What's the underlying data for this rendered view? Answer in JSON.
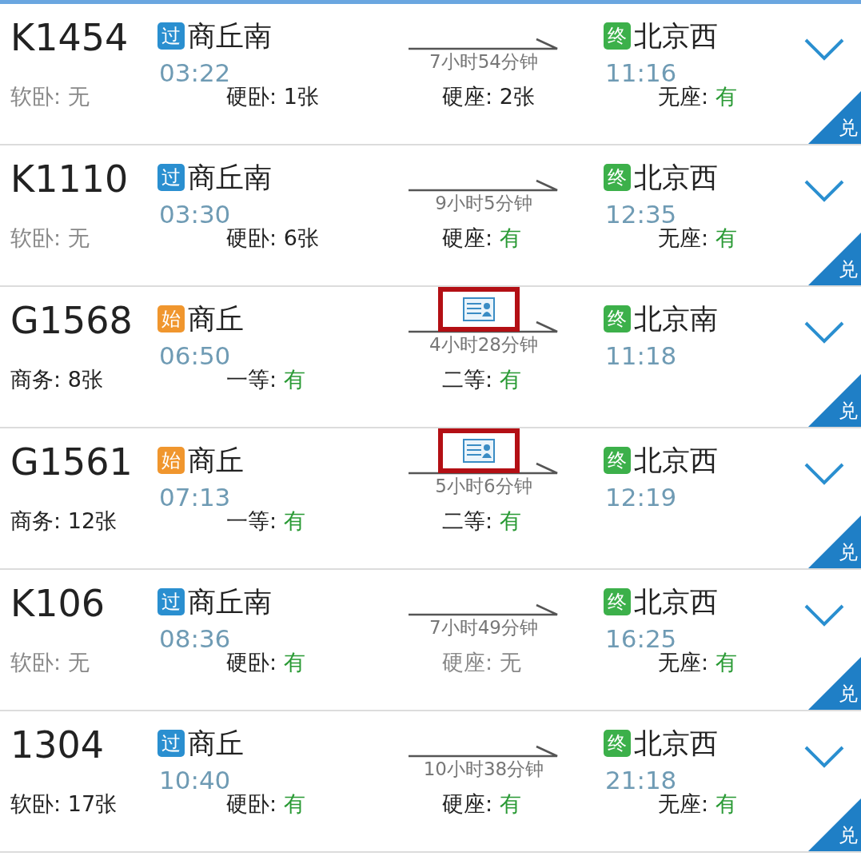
{
  "trains": [
    {
      "number": "K1454",
      "from": {
        "badge": "过",
        "kind": "pass",
        "station": "商丘南",
        "time": "03:22"
      },
      "duration": "7小时54分钟",
      "id_card": false,
      "to": {
        "badge": "终",
        "kind": "end",
        "station": "北京西",
        "time": "11:16"
      },
      "corner": "兑",
      "seats": [
        {
          "label": "软卧:",
          "value": "无",
          "kind": "none"
        },
        {
          "label": "硬卧:",
          "value": "1张",
          "kind": "count"
        },
        {
          "label": "硬座:",
          "value": "2张",
          "kind": "count"
        },
        {
          "label": "无座:",
          "value": "有",
          "kind": "available"
        }
      ]
    },
    {
      "number": "K1110",
      "from": {
        "badge": "过",
        "kind": "pass",
        "station": "商丘南",
        "time": "03:30"
      },
      "duration": "9小时5分钟",
      "id_card": false,
      "to": {
        "badge": "终",
        "kind": "end",
        "station": "北京西",
        "time": "12:35"
      },
      "corner": "兑",
      "seats": [
        {
          "label": "软卧:",
          "value": "无",
          "kind": "none"
        },
        {
          "label": "硬卧:",
          "value": "6张",
          "kind": "count"
        },
        {
          "label": "硬座:",
          "value": "有",
          "kind": "available"
        },
        {
          "label": "无座:",
          "value": "有",
          "kind": "available"
        }
      ]
    },
    {
      "number": "G1568",
      "from": {
        "badge": "始",
        "kind": "start",
        "station": "商丘",
        "time": "06:50"
      },
      "duration": "4小时28分钟",
      "id_card": true,
      "to": {
        "badge": "终",
        "kind": "end",
        "station": "北京南",
        "time": "11:18"
      },
      "corner": "兑",
      "seats": [
        {
          "label": "商务:",
          "value": "8张",
          "kind": "count"
        },
        {
          "label": "一等:",
          "value": "有",
          "kind": "available"
        },
        {
          "label": "二等:",
          "value": "有",
          "kind": "available"
        }
      ]
    },
    {
      "number": "G1561",
      "from": {
        "badge": "始",
        "kind": "start",
        "station": "商丘",
        "time": "07:13"
      },
      "duration": "5小时6分钟",
      "id_card": true,
      "to": {
        "badge": "终",
        "kind": "end",
        "station": "北京西",
        "time": "12:19"
      },
      "corner": "兑",
      "seats": [
        {
          "label": "商务:",
          "value": "12张",
          "kind": "count"
        },
        {
          "label": "一等:",
          "value": "有",
          "kind": "available"
        },
        {
          "label": "二等:",
          "value": "有",
          "kind": "available"
        }
      ]
    },
    {
      "number": "K106",
      "from": {
        "badge": "过",
        "kind": "pass",
        "station": "商丘南",
        "time": "08:36"
      },
      "duration": "7小时49分钟",
      "id_card": false,
      "to": {
        "badge": "终",
        "kind": "end",
        "station": "北京西",
        "time": "16:25"
      },
      "corner": "兑",
      "seats": [
        {
          "label": "软卧:",
          "value": "无",
          "kind": "none"
        },
        {
          "label": "硬卧:",
          "value": "有",
          "kind": "available"
        },
        {
          "label": "硬座:",
          "value": "无",
          "kind": "none"
        },
        {
          "label": "无座:",
          "value": "有",
          "kind": "available"
        }
      ]
    },
    {
      "number": "1304",
      "from": {
        "badge": "过",
        "kind": "pass",
        "station": "商丘",
        "time": "10:40"
      },
      "duration": "10小时38分钟",
      "id_card": false,
      "to": {
        "badge": "终",
        "kind": "end",
        "station": "北京西",
        "time": "21:18"
      },
      "corner": "兑",
      "seats": [
        {
          "label": "软卧:",
          "value": "17张",
          "kind": "count"
        },
        {
          "label": "硬卧:",
          "value": "有",
          "kind": "available"
        },
        {
          "label": "硬座:",
          "value": "有",
          "kind": "available"
        },
        {
          "label": "无座:",
          "value": "有",
          "kind": "available"
        }
      ]
    }
  ]
}
